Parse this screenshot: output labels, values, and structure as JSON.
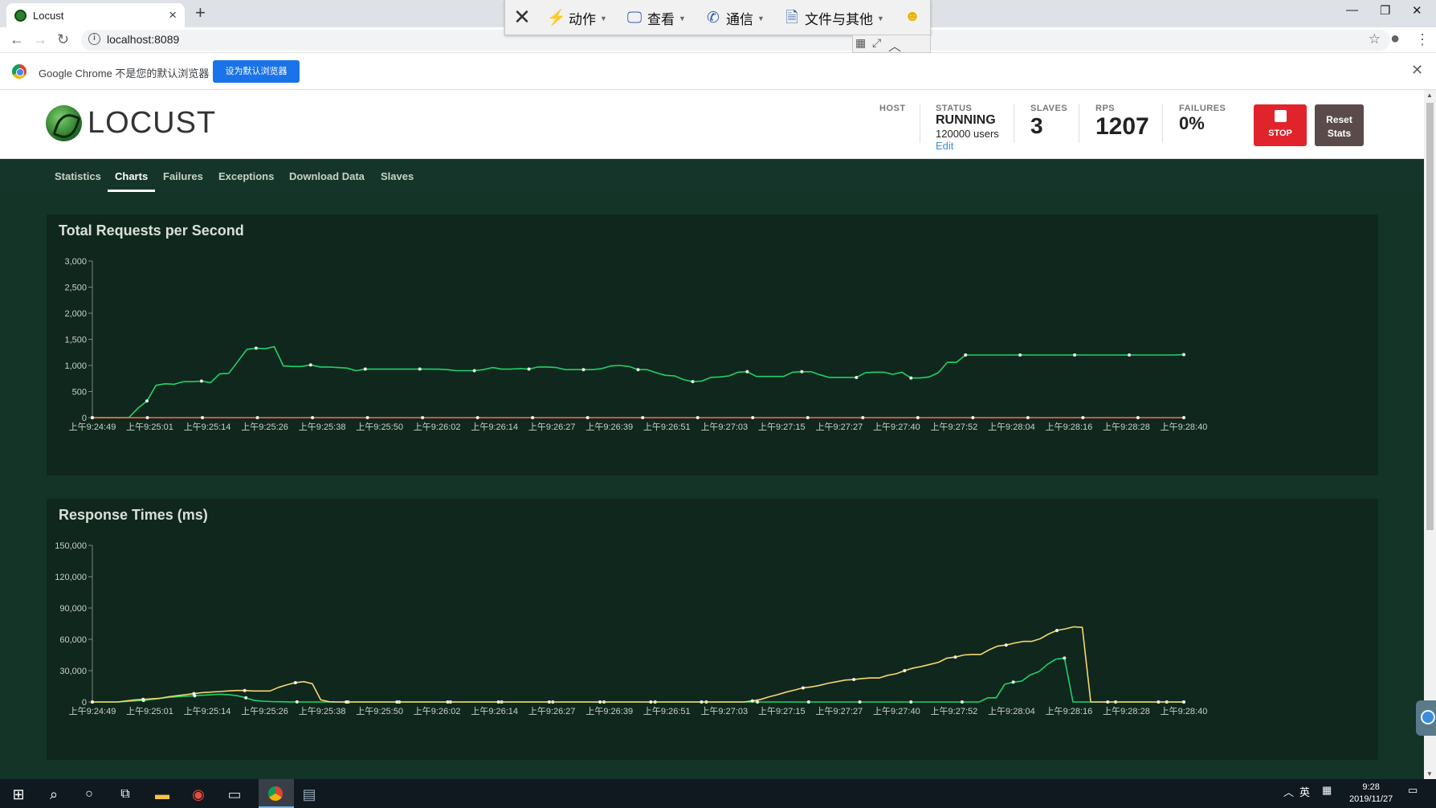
{
  "browser": {
    "tab_title": "Locust",
    "new_tab_icon": "+",
    "url": "localhost:8089",
    "infobar_message": "Google Chrome 不是您的默认浏览器",
    "infobar_button": "设为默认浏览器"
  },
  "remote_toolbar": {
    "items": [
      {
        "label": "动作",
        "icon": "lightning-icon"
      },
      {
        "label": "查看",
        "icon": "monitor-icon"
      },
      {
        "label": "通信",
        "icon": "phone-icon"
      },
      {
        "label": "文件与其他",
        "icon": "file-transfer-icon"
      }
    ]
  },
  "locust": {
    "brand": "LOCUST",
    "host_label": "HOST",
    "status_label": "STATUS",
    "status_value": "RUNNING",
    "status_users": "120000 users",
    "status_edit": "Edit",
    "slaves_label": "SLAVES",
    "slaves_value": "3",
    "rps_label": "RPS",
    "rps_value": "1207",
    "failures_label": "FAILURES",
    "failures_value": "0%",
    "stop_label": "STOP",
    "reset_label_line1": "Reset",
    "reset_label_line2": "Stats",
    "tabs": [
      "Statistics",
      "Charts",
      "Failures",
      "Exceptions",
      "Download Data",
      "Slaves"
    ],
    "active_tab": "Charts"
  },
  "taskbar": {
    "lang": "英",
    "time": "9:28",
    "date": "2019/11/27"
  },
  "colors": {
    "primary_line": "#1fd26a",
    "secondary_line": "#f5d76e",
    "failure_line": "#ff6d4a",
    "panel_bg": "#10271d",
    "page_bg": "#143428",
    "stop_red": "#e1242b"
  },
  "chart_data": [
    {
      "type": "line",
      "title": "Total Requests per Second",
      "ylim": [
        0,
        3000
      ],
      "yticks": [
        "0",
        "500",
        "1,000",
        "1,500",
        "2,000",
        "2,500",
        "3,000"
      ],
      "xticks": [
        "上午9:24:49",
        "上午9:25:01",
        "上午9:25:14",
        "上午9:25:26",
        "上午9:25:38",
        "上午9:25:50",
        "上午9:26:02",
        "上午9:26:14",
        "上午9:26:27",
        "上午9:26:39",
        "上午9:26:51",
        "上午9:27:03",
        "上午9:27:15",
        "上午9:27:27",
        "上午9:27:40",
        "上午9:27:52",
        "上午9:28:04",
        "上午9:28:16",
        "上午9:28:28",
        "上午9:28:40"
      ],
      "series": [
        {
          "color": "#1fd26a",
          "values": [
            0,
            0,
            0,
            0,
            0,
            180,
            320,
            620,
            650,
            640,
            690,
            690,
            700,
            670,
            840,
            850,
            1080,
            1310,
            1330,
            1320,
            1360,
            990,
            980,
            980,
            1010,
            970,
            970,
            960,
            950,
            900,
            930,
            930,
            930,
            930,
            930,
            930,
            930,
            930,
            930,
            920,
            900,
            900,
            900,
            920,
            960,
            930,
            930,
            940,
            930,
            970,
            970,
            960,
            920,
            920,
            920,
            920,
            940,
            990,
            1000,
            980,
            920,
            920,
            860,
            810,
            800,
            730,
            690,
            700,
            770,
            780,
            800,
            870,
            880,
            790,
            790,
            790,
            790,
            870,
            880,
            880,
            820,
            770,
            770,
            770,
            770,
            860,
            870,
            870,
            830,
            870,
            760,
            760,
            780,
            860,
            1060,
            1060,
            1200,
            1200,
            1200,
            1200,
            1200,
            1200,
            1200,
            1200,
            1200,
            1200,
            1200,
            1200,
            1200,
            1200,
            1200,
            1200,
            1200,
            1200,
            1200,
            1200,
            1200,
            1200,
            1200,
            1200,
            1207
          ]
        },
        {
          "color": "#ff6d4a",
          "values": [
            0,
            0,
            0,
            0,
            0,
            0,
            0,
            0,
            0,
            0,
            0,
            0,
            0,
            0,
            0,
            0,
            0,
            0,
            0,
            0,
            0,
            0,
            0,
            0,
            0,
            0,
            0,
            0,
            0,
            0,
            0,
            0,
            0,
            0,
            0,
            0,
            0,
            0,
            0,
            0,
            0,
            0,
            0,
            0,
            0,
            0,
            0,
            0,
            0,
            0,
            0,
            0,
            0,
            0,
            0,
            0,
            0,
            0,
            0,
            0,
            0,
            0,
            0,
            0,
            0,
            0,
            0,
            0,
            0,
            0,
            0,
            0,
            0,
            0,
            0,
            0,
            0,
            0,
            0,
            0,
            0,
            0,
            0,
            0,
            0,
            0,
            0,
            0,
            0,
            0,
            0,
            0,
            0,
            0,
            0,
            0,
            0,
            0,
            0,
            0,
            0,
            0,
            0,
            0,
            0,
            0,
            0,
            0,
            0,
            0,
            0,
            0,
            0,
            0,
            0,
            0,
            0,
            0,
            0,
            0
          ]
        }
      ]
    },
    {
      "type": "line",
      "title": "Response Times (ms)",
      "ylim": [
        0,
        150000
      ],
      "yticks": [
        "0",
        "30,000",
        "60,000",
        "90,000",
        "120,000",
        "150,000"
      ],
      "xticks": [
        "上午9:24:49",
        "上午9:25:01",
        "上午9:25:14",
        "上午9:25:26",
        "上午9:25:38",
        "上午9:25:50",
        "上午9:26:02",
        "上午9:26:14",
        "上午9:26:27",
        "上午9:26:39",
        "上午9:26:51",
        "上午9:27:03",
        "上午9:27:15",
        "上午9:27:27",
        "上午9:27:40",
        "上午9:27:52",
        "上午9:28:04",
        "上午9:28:16",
        "上午9:28:28",
        "上午9:28:40"
      ],
      "series": [
        {
          "color": "#1fd26a",
          "values": [
            0,
            0,
            0,
            0,
            500,
            1000,
            1500,
            2500,
            3500,
            4500,
            5000,
            5500,
            6000,
            6500,
            7000,
            7500,
            7000,
            6000,
            4000,
            1500,
            800,
            400,
            200,
            100,
            50,
            0,
            0,
            0,
            0,
            0,
            0,
            0,
            0,
            0,
            0,
            0,
            0,
            0,
            0,
            0,
            0,
            0,
            0,
            0,
            0,
            0,
            0,
            0,
            0,
            0,
            0,
            0,
            0,
            0,
            0,
            0,
            0,
            0,
            0,
            0,
            0,
            0,
            0,
            0,
            0,
            0,
            0,
            0,
            0,
            0,
            0,
            0,
            0,
            0,
            0,
            0,
            0,
            0,
            0,
            0,
            0,
            0,
            0,
            0,
            0,
            0,
            0,
            0,
            0,
            0,
            0,
            0,
            0,
            0,
            0,
            0,
            0,
            0,
            0,
            0,
            0,
            0,
            0,
            0,
            0,
            4000,
            4000,
            17000,
            19000,
            20000,
            26000,
            29000,
            36000,
            41000,
            42000,
            0,
            0,
            0,
            0,
            0,
            0,
            0,
            0,
            0,
            0,
            0,
            0,
            0,
            0
          ]
        },
        {
          "color": "#f5d76e",
          "values": [
            0,
            0,
            0,
            0,
            1000,
            2000,
            2500,
            3000,
            3500,
            5000,
            6000,
            7000,
            8000,
            9000,
            9500,
            10000,
            10500,
            11000,
            11000,
            10500,
            10500,
            10500,
            14000,
            16500,
            18500,
            19500,
            17500,
            2000,
            200,
            0,
            0,
            0,
            0,
            0,
            0,
            0,
            0,
            0,
            0,
            0,
            0,
            0,
            0,
            0,
            0,
            0,
            0,
            0,
            0,
            0,
            0,
            0,
            0,
            0,
            0,
            0,
            0,
            0,
            0,
            0,
            0,
            0,
            0,
            0,
            0,
            0,
            0,
            0,
            0,
            0,
            0,
            0,
            0,
            0,
            0,
            0,
            0,
            0,
            1000,
            2500,
            5000,
            7000,
            9500,
            11500,
            13500,
            14500,
            16000,
            18000,
            19500,
            21000,
            21500,
            22500,
            23000,
            23000,
            25500,
            27000,
            30000,
            32500,
            34000,
            36000,
            38000,
            42000,
            43000,
            45000,
            45500,
            45500,
            50000,
            53500,
            54500,
            56500,
            58000,
            58000,
            60500,
            65000,
            68500,
            70000,
            72000,
            71500,
            0,
            0,
            0,
            0,
            0,
            0,
            0,
            0,
            0,
            0,
            0,
            0
          ]
        }
      ]
    }
  ]
}
